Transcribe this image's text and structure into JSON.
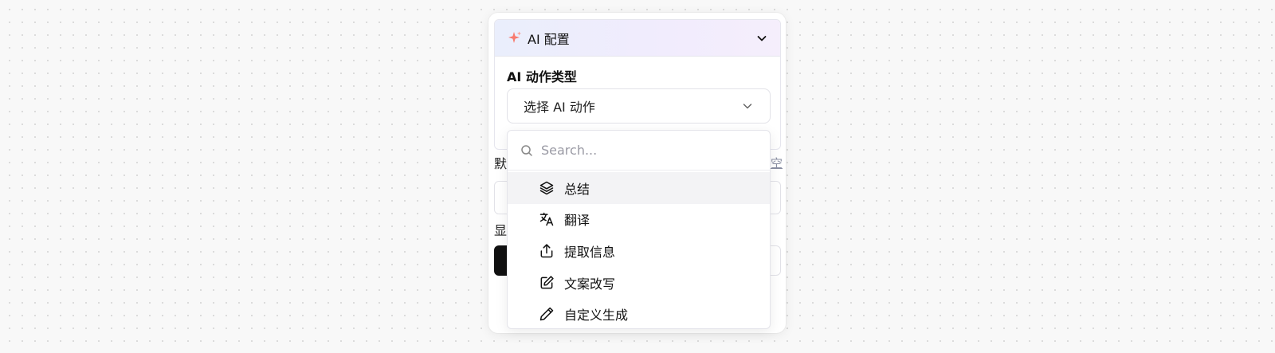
{
  "panel": {
    "header_title": "AI 配置",
    "field_label": "AI 动作类型",
    "select_value": "选择 AI 动作",
    "behind_label_1": "默",
    "behind_link": "空",
    "behind_label_2": "显"
  },
  "dropdown": {
    "search_placeholder": "Search...",
    "items": [
      {
        "label": "总结",
        "icon": "layers-icon"
      },
      {
        "label": "翻译",
        "icon": "translate-icon"
      },
      {
        "label": "提取信息",
        "icon": "share-upload-icon"
      },
      {
        "label": "文案改写",
        "icon": "edit-square-icon"
      },
      {
        "label": "自定义生成",
        "icon": "pencil-icon"
      }
    ],
    "highlighted_index": 0
  },
  "colors": {
    "sparkle_accent": "#f87a6e",
    "header_gradient_start": "#eaeefc",
    "header_gradient_end": "#f5eefc",
    "highlight_bg": "#f3f3f5"
  }
}
